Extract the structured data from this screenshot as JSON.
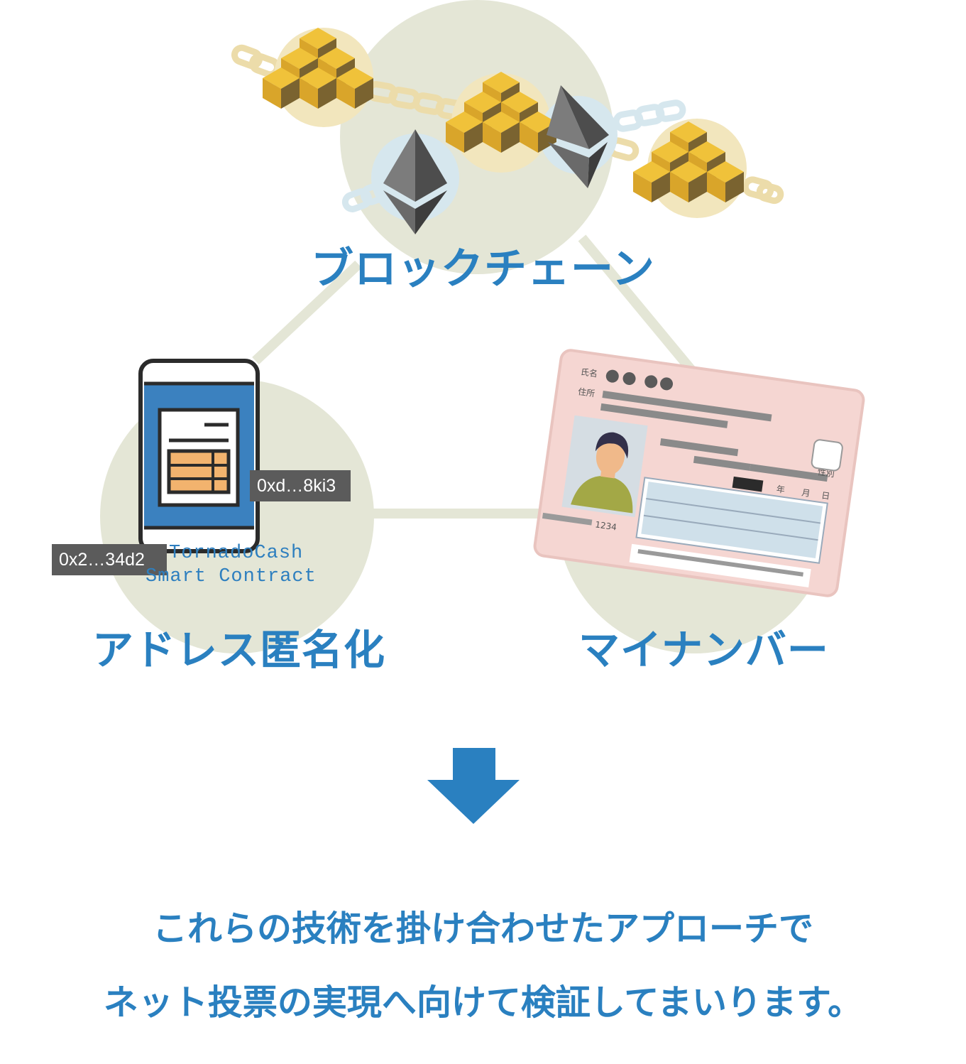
{
  "colors": {
    "blue": "#2a80c0",
    "circle": "#e4e6d6",
    "gold_top": "#f0c23a",
    "gold_left": "#d9a52a",
    "gold_right": "#7a6330",
    "card": "#f5d6d2",
    "card_box": "#cfe0ea",
    "phone_screen": "#3b81bf"
  },
  "labels": {
    "blockchain": "ブロックチェーン",
    "anonymization": "アドレス匿名化",
    "my_number": "マイナンバー"
  },
  "phone": {
    "address_1": "0xd…8ki3",
    "address_2": "0x2…34d2",
    "contract_line_1": "TornadoCash",
    "contract_line_2": "Smart Contract"
  },
  "card": {
    "name_label": "氏名",
    "address_label": "住所",
    "sex_label": "性別",
    "year": "年",
    "month": "月",
    "day": "日",
    "number": "1234"
  },
  "arrow": {
    "icon": "down-arrow-icon"
  },
  "conclusion": {
    "line_1": "これらの技術を掛け合わせたアプローチで",
    "line_2": "ネット投票の実現へ向けて検証してまいります。"
  }
}
